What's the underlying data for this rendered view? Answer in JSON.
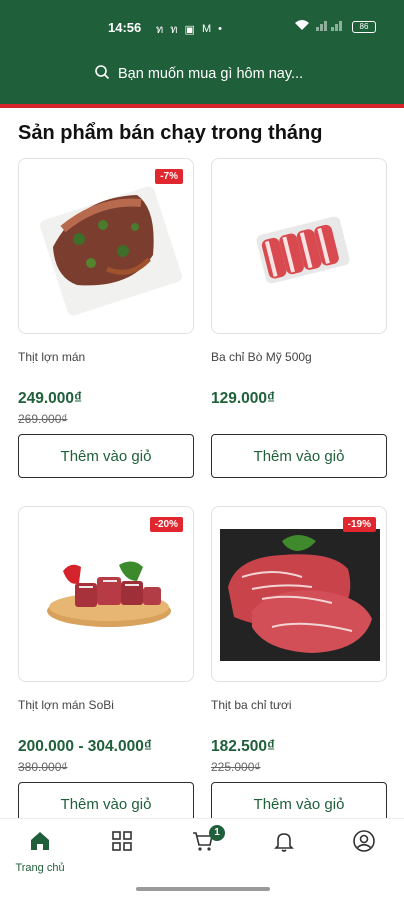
{
  "status_bar": {
    "time": "14:56",
    "battery": "86",
    "glyphs": [
      "ท",
      "ท",
      "▣",
      "M",
      "•"
    ]
  },
  "search": {
    "placeholder": "Bạn muốn mua gì hôm nay..."
  },
  "section": {
    "title": "Sản phẩm bán chạy trong tháng"
  },
  "products": [
    {
      "name": "Thịt lợn mán",
      "price": "249.000₫",
      "old_price": "269.000₫",
      "badge": "-7%",
      "button": "Thêm vào giỏ"
    },
    {
      "name": "Ba chỉ Bò Mỹ 500g",
      "price": "129.000₫",
      "old_price": "",
      "badge": "",
      "button": "Thêm vào giỏ"
    },
    {
      "name": "Thịt lợn mán SoBi",
      "price": "200.000 - 304.000₫",
      "old_price": "380.000₫",
      "badge": "-20%",
      "button": "Thêm vào giỏ"
    },
    {
      "name": "Thịt ba chỉ tươi",
      "price": "182.500₫",
      "old_price": "225.000₫",
      "badge": "-19%",
      "button": "Thêm vào giỏ"
    }
  ],
  "bottom_nav": {
    "home_label": "Trang chủ",
    "cart_count": "1",
    "items": [
      {
        "icon": "home-icon"
      },
      {
        "icon": "grid-icon"
      },
      {
        "icon": "cart-icon"
      },
      {
        "icon": "bell-icon"
      },
      {
        "icon": "user-icon"
      }
    ]
  },
  "colors": {
    "brand_green": "#1f5f3a",
    "accent_red": "#d8242a"
  }
}
